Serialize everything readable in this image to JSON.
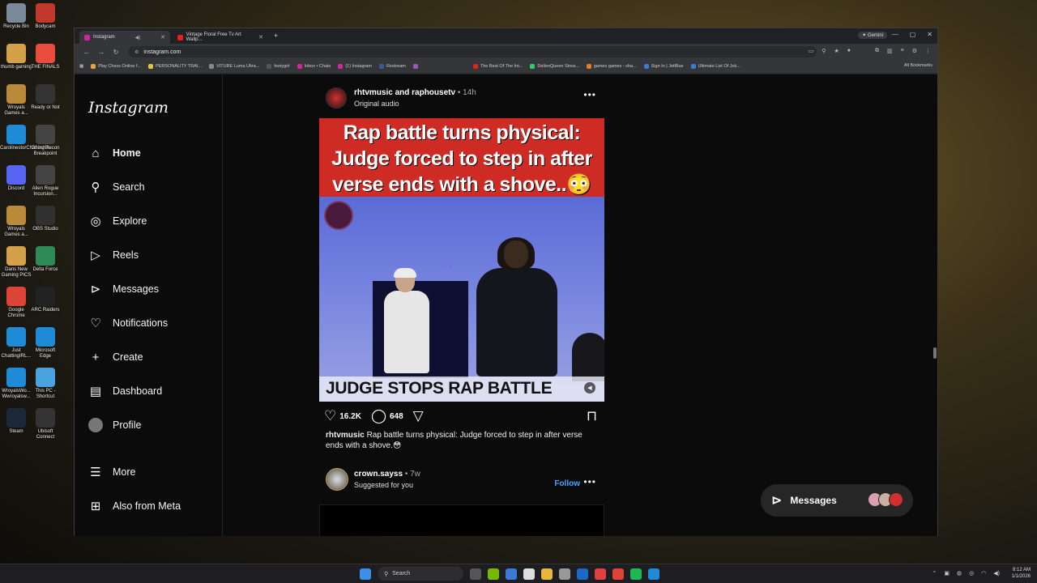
{
  "desktop": {
    "icons": [
      {
        "label": "Recycle Bin",
        "color": "#7a8a9a"
      },
      {
        "label": "Bodycam",
        "color": "#c0392b"
      },
      {
        "label": "thumb gaming",
        "color": "#d4a14a"
      },
      {
        "label": "THE FINALS",
        "color": "#e74c3c"
      },
      {
        "label": "Wroyals Games a...",
        "color": "#b88a3a"
      },
      {
        "label": "Ready or Not",
        "color": "#333333"
      },
      {
        "label": "CarolinestorChattingUs...",
        "color": "#1f8ad6"
      },
      {
        "label": "Ghost Recon Breakpoint",
        "color": "#444444"
      },
      {
        "label": "Discord",
        "color": "#5865f2"
      },
      {
        "label": "Alien Rogue Incursion...",
        "color": "#444444"
      },
      {
        "label": "Wroyals Games a...",
        "color": "#b88a3a"
      },
      {
        "label": "OBS Studio",
        "color": "#303030"
      },
      {
        "label": "Dans New Gaming PICS",
        "color": "#d4a14a"
      },
      {
        "label": "Delta Force",
        "color": "#2e8b57"
      },
      {
        "label": "Google Chrome",
        "color": "#db4437"
      },
      {
        "label": "ARC Raiders",
        "color": "#222222"
      },
      {
        "label": "Just ChattingIRL...",
        "color": "#1f8ad6"
      },
      {
        "label": "Microsoft Edge",
        "color": "#1f8ad6"
      },
      {
        "label": "WroyalsWo... Wwroyalsw...",
        "color": "#1f8ad6"
      },
      {
        "label": "This PC - Shortcut",
        "color": "#4aa3df"
      },
      {
        "label": "Steam",
        "color": "#1b2838"
      },
      {
        "label": "Ubisoft Connect",
        "color": "#333333"
      }
    ]
  },
  "browser": {
    "tabs": [
      {
        "title": "Instagram",
        "active": true
      },
      {
        "title": "Vintage Floral Free Tv Art Wallp...",
        "active": false
      }
    ],
    "new_tab": "+",
    "gemini_label": "Gemini",
    "url": "instagram.com",
    "bookmarks": [
      "Play Chess Online f...",
      "PERSONALITY TRAI...",
      "VITURE Luma Ultra...",
      "feetygirl",
      "Inbox • Chats",
      "(1) Instagram",
      "Restream",
      "",
      "The Best Of The Int...",
      "DellenQueen Strea...",
      "games games - sha...",
      "Sign In | JetBlue",
      "Ultimate List Of Jok..."
    ],
    "all_bookmarks": "All Bookmarks"
  },
  "instagram": {
    "logo": "Instagram",
    "nav": [
      {
        "label": "Home",
        "icon": "home-icon",
        "glyph": "⌂",
        "bold": true
      },
      {
        "label": "Search",
        "icon": "search-icon",
        "glyph": "⚲",
        "bold": false
      },
      {
        "label": "Explore",
        "icon": "compass-icon",
        "glyph": "◎",
        "bold": false
      },
      {
        "label": "Reels",
        "icon": "reels-icon",
        "glyph": "▷",
        "bold": false
      },
      {
        "label": "Messages",
        "icon": "messages-icon",
        "glyph": "⊳",
        "bold": false
      },
      {
        "label": "Notifications",
        "icon": "heart-icon",
        "glyph": "♡",
        "bold": false
      },
      {
        "label": "Create",
        "icon": "plus-icon",
        "glyph": "+",
        "bold": false
      },
      {
        "label": "Dashboard",
        "icon": "dashboard-icon",
        "glyph": "▤",
        "bold": false
      },
      {
        "label": "Profile",
        "icon": "profile-avatar-icon",
        "glyph": "●",
        "bold": false
      },
      {
        "label": "More",
        "icon": "menu-icon",
        "glyph": "☰",
        "bold": false
      },
      {
        "label": "Also from Meta",
        "icon": "meta-icon",
        "glyph": "⊞",
        "bold": false
      }
    ],
    "post1": {
      "authors": "rhtvmusic and raphousetv",
      "time": "14h",
      "sub": "Original audio",
      "headline": "Rap battle turns physical: Judge forced to step in after verse ends with a shove..😳",
      "video_caption": "JUDGE STOPS RAP BATTLE",
      "likes": "16.2K",
      "comments": "648",
      "caption_user": "rhtvmusic",
      "caption_text": "Rap battle turns physical: Judge forced to step in after verse ends with a shove.😳"
    },
    "post2": {
      "author": "crown.sayss",
      "time": "7w",
      "sub": "Suggested for you",
      "follow_label": "Follow"
    },
    "messages_pill": "Messages"
  },
  "taskbar": {
    "search_placeholder": "Search",
    "time": "8:12 AM",
    "date": "1/1/2026"
  }
}
